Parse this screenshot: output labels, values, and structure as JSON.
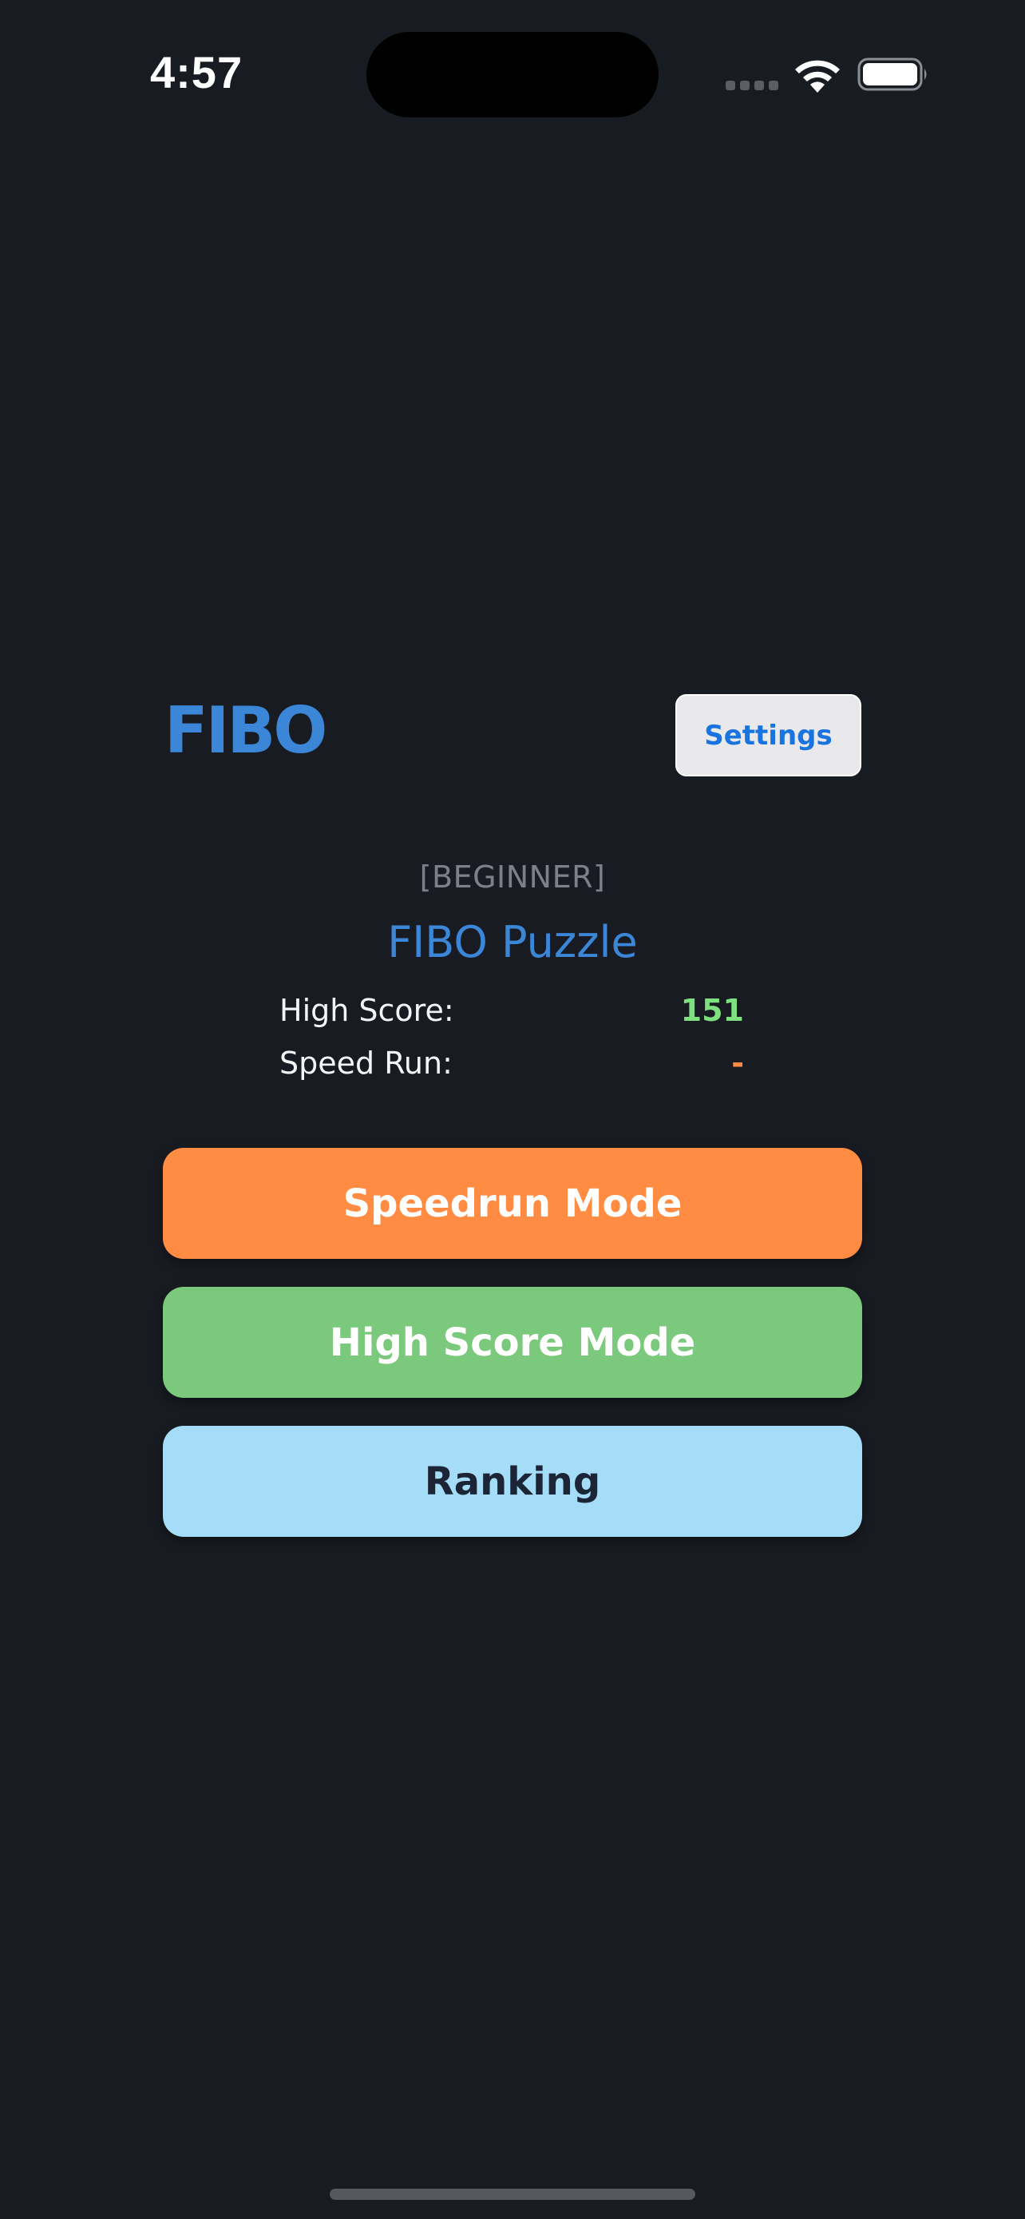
{
  "status_bar": {
    "time": "4:57",
    "icons": [
      "cellular-signal-icon",
      "wifi-icon",
      "battery-icon"
    ]
  },
  "header": {
    "logo": "FIBO",
    "settings_label": "Settings"
  },
  "info": {
    "difficulty": "[BEGINNER]",
    "title": "FIBO Puzzle",
    "stats": [
      {
        "label": "High Score:",
        "value": "151"
      },
      {
        "label": "Speed Run:",
        "value": "-"
      }
    ]
  },
  "buttons": {
    "speedrun": "Speedrun Mode",
    "highscore": "High Score Mode",
    "ranking": "Ranking"
  },
  "colors": {
    "background": "#181b21",
    "accent_blue": "#3b86d6",
    "speedrun_orange": "#ff8c42",
    "highscore_green": "#7bc97c",
    "ranking_light_blue": "#a5dcf8",
    "score_green": "#7ee07f"
  }
}
